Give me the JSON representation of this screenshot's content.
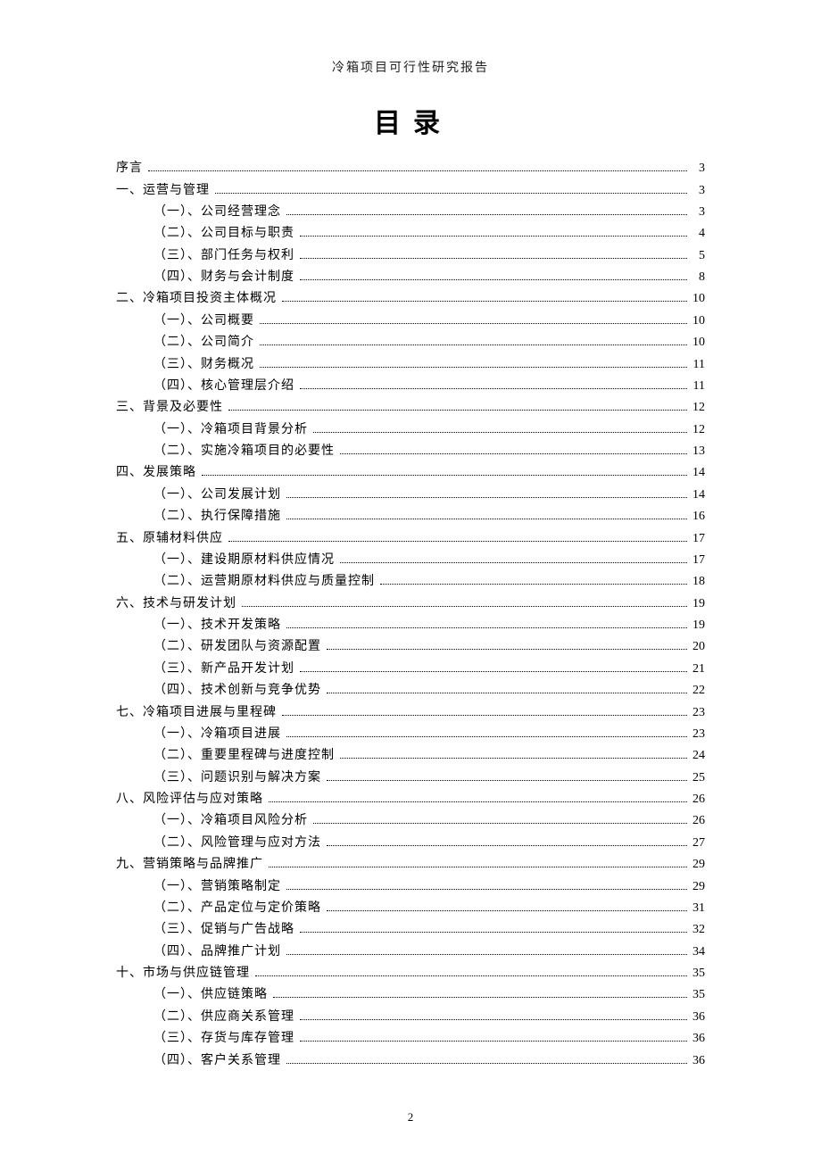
{
  "running_header": "冷箱项目可行性研究报告",
  "toc_title": "目录",
  "page_number": "2",
  "toc": [
    {
      "level": 0,
      "label": "序言",
      "page": "3"
    },
    {
      "level": 0,
      "label": "一、运营与管理",
      "page": "3"
    },
    {
      "level": 1,
      "label": "（一）、公司经营理念",
      "page": "3"
    },
    {
      "level": 1,
      "label": "（二）、公司目标与职责",
      "page": "4"
    },
    {
      "level": 1,
      "label": "（三）、部门任务与权利",
      "page": "5"
    },
    {
      "level": 1,
      "label": "（四）、财务与会计制度",
      "page": "8"
    },
    {
      "level": 0,
      "label": "二、冷箱项目投资主体概况",
      "page": "10"
    },
    {
      "level": 1,
      "label": "（一）、公司概要",
      "page": "10"
    },
    {
      "level": 1,
      "label": "（二）、公司简介",
      "page": "10"
    },
    {
      "level": 1,
      "label": "（三）、财务概况",
      "page": "11"
    },
    {
      "level": 1,
      "label": "（四）、核心管理层介绍",
      "page": "11"
    },
    {
      "level": 0,
      "label": "三、背景及必要性",
      "page": "12"
    },
    {
      "level": 1,
      "label": "（一）、冷箱项目背景分析",
      "page": "12"
    },
    {
      "level": 1,
      "label": "（二）、实施冷箱项目的必要性",
      "page": "13"
    },
    {
      "level": 0,
      "label": "四、发展策略",
      "page": "14"
    },
    {
      "level": 1,
      "label": "（一）、公司发展计划",
      "page": "14"
    },
    {
      "level": 1,
      "label": "（二）、执行保障措施",
      "page": "16"
    },
    {
      "level": 0,
      "label": "五、原辅材料供应",
      "page": "17"
    },
    {
      "level": 1,
      "label": "（一）、建设期原材料供应情况",
      "page": "17"
    },
    {
      "level": 1,
      "label": "（二）、运营期原材料供应与质量控制",
      "page": "18"
    },
    {
      "level": 0,
      "label": "六、技术与研发计划",
      "page": "19"
    },
    {
      "level": 1,
      "label": "（一）、技术开发策略",
      "page": "19"
    },
    {
      "level": 1,
      "label": "（二）、研发团队与资源配置",
      "page": "20"
    },
    {
      "level": 1,
      "label": "（三）、新产品开发计划",
      "page": "21"
    },
    {
      "level": 1,
      "label": "（四）、技术创新与竞争优势",
      "page": "22"
    },
    {
      "level": 0,
      "label": "七、冷箱项目进展与里程碑",
      "page": "23"
    },
    {
      "level": 1,
      "label": "（一）、冷箱项目进展",
      "page": "23"
    },
    {
      "level": 1,
      "label": "（二）、重要里程碑与进度控制",
      "page": "24"
    },
    {
      "level": 1,
      "label": "（三）、问题识别与解决方案",
      "page": "25"
    },
    {
      "level": 0,
      "label": "八、风险评估与应对策略",
      "page": "26"
    },
    {
      "level": 1,
      "label": "（一）、冷箱项目风险分析",
      "page": "26"
    },
    {
      "level": 1,
      "label": "（二）、风险管理与应对方法",
      "page": "27"
    },
    {
      "level": 0,
      "label": "九、营销策略与品牌推广",
      "page": "29"
    },
    {
      "level": 1,
      "label": "（一）、营销策略制定",
      "page": "29"
    },
    {
      "level": 1,
      "label": "（二）、产品定位与定价策略",
      "page": "31"
    },
    {
      "level": 1,
      "label": "（三）、促销与广告战略",
      "page": "32"
    },
    {
      "level": 1,
      "label": "（四）、品牌推广计划",
      "page": "34"
    },
    {
      "level": 0,
      "label": "十、市场与供应链管理",
      "page": "35"
    },
    {
      "level": 1,
      "label": "（一）、供应链策略",
      "page": "35"
    },
    {
      "level": 1,
      "label": "（二）、供应商关系管理",
      "page": "36"
    },
    {
      "level": 1,
      "label": "（三）、存货与库存管理",
      "page": "36"
    },
    {
      "level": 1,
      "label": "（四）、客户关系管理",
      "page": "36"
    }
  ]
}
